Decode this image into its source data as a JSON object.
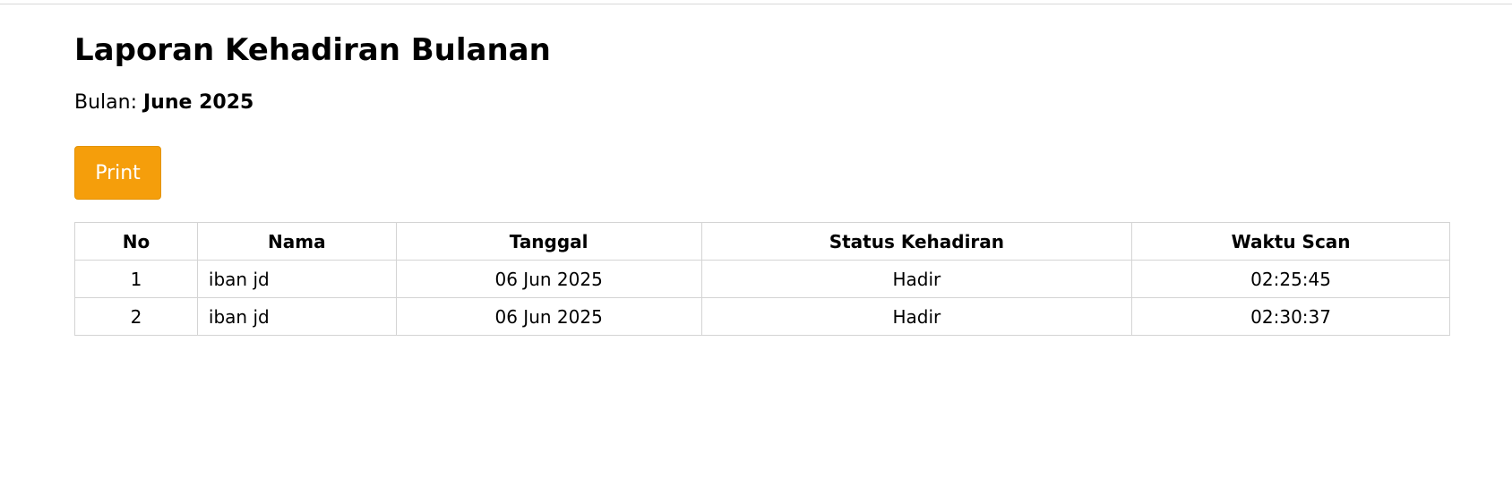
{
  "page": {
    "title": "Laporan Kehadiran Bulanan",
    "month_label": "Bulan:",
    "month_value": "June 2025",
    "print_label": "Print",
    "accent_color": "#f59e0b"
  },
  "table": {
    "headers": {
      "no": "No",
      "nama": "Nama",
      "tanggal": "Tanggal",
      "status": "Status Kehadiran",
      "waktu": "Waktu Scan"
    },
    "rows": [
      {
        "no": "1",
        "nama": "iban jd",
        "tanggal": "06 Jun 2025",
        "status": "Hadir",
        "waktu": "02:25:45"
      },
      {
        "no": "2",
        "nama": "iban jd",
        "tanggal": "06 Jun 2025",
        "status": "Hadir",
        "waktu": "02:30:37"
      }
    ]
  }
}
